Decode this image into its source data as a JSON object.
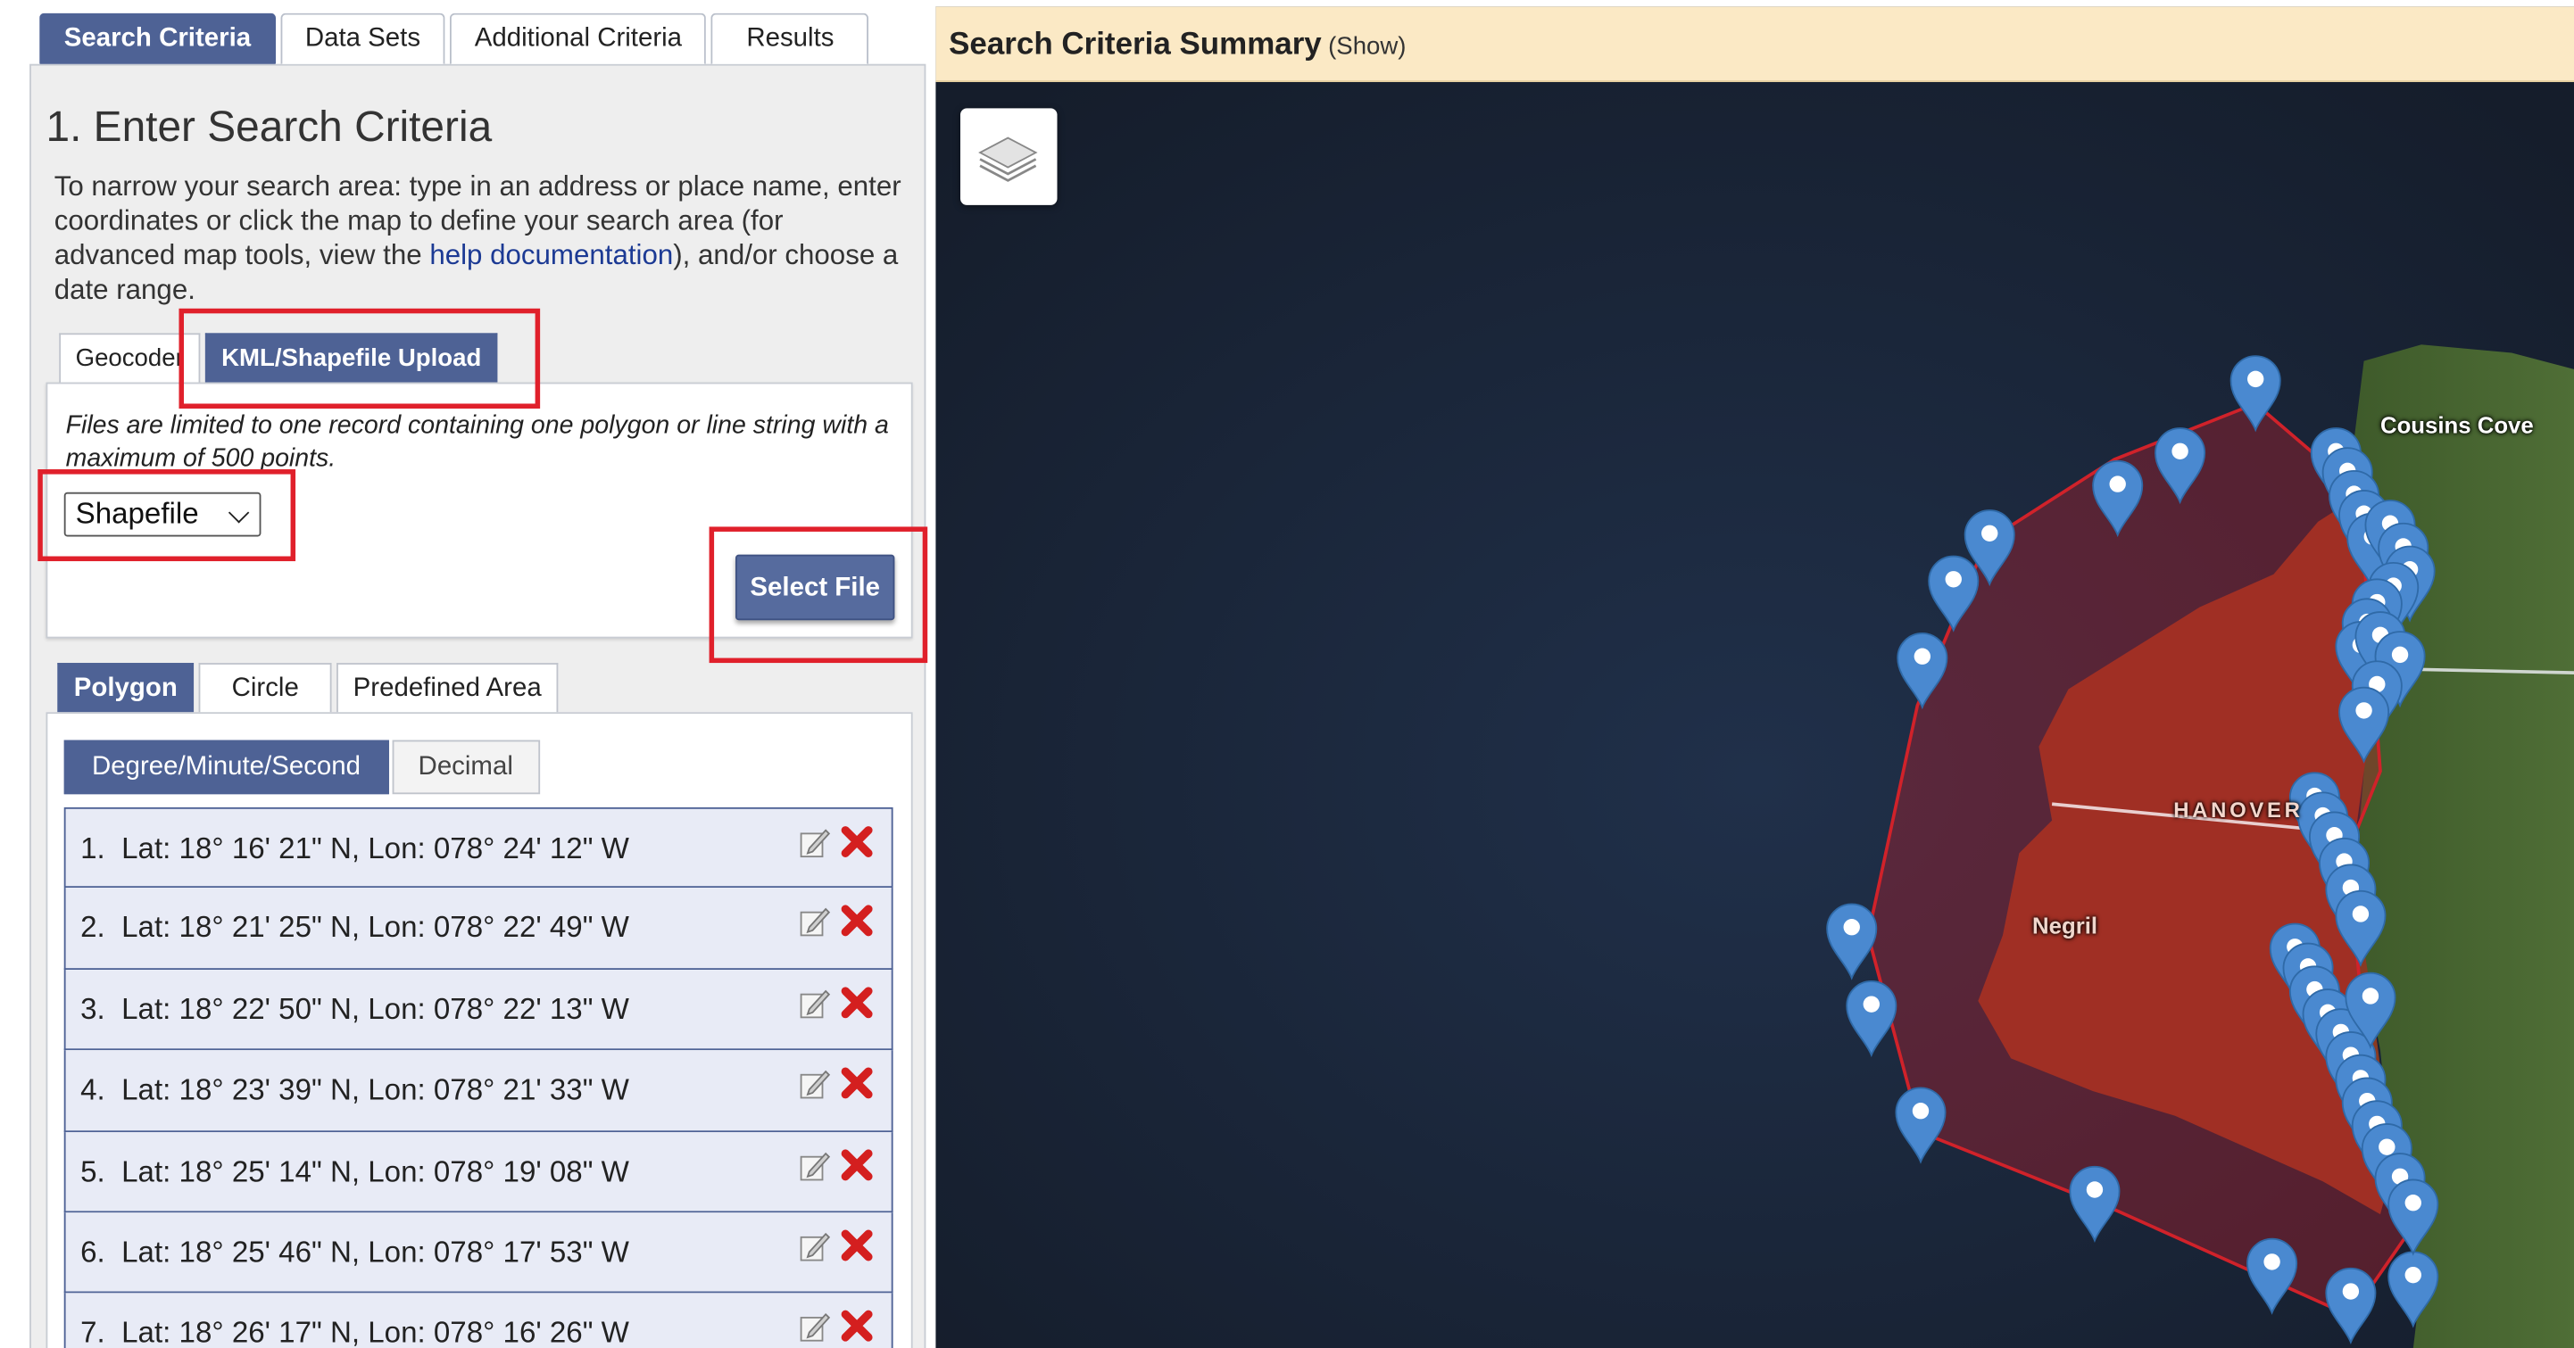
{
  "main_tabs": [
    "Search Criteria",
    "Data Sets",
    "Additional Criteria",
    "Results"
  ],
  "section_title": "1. Enter Search Criteria",
  "intro": {
    "before_link": "To narrow your search area: type in an address or place name, enter coordinates or click the map to define your search area (for advanced map tools, view the ",
    "link": "help documentation",
    "after_link": "), and/or choose a date range."
  },
  "sub_tabs": [
    "Geocoder",
    "KML/Shapefile Upload"
  ],
  "upload": {
    "note": "Files are limited to one record containing one polygon or line string with a maximum of 500 points.",
    "format_selected": "Shapefile",
    "select_file_label": "Select File"
  },
  "geo_tabs": [
    "Polygon",
    "Circle",
    "Predefined Area"
  ],
  "format_tabs": [
    "Degree/Minute/Second",
    "Decimal"
  ],
  "coordinates": [
    "1.  Lat: 18° 16' 21\" N, Lon: 078° 24' 12\" W",
    "2.  Lat: 18° 21' 25\" N, Lon: 078° 22' 49\" W",
    "3.  Lat: 18° 22' 50\" N, Lon: 078° 22' 13\" W",
    "4.  Lat: 18° 23' 39\" N, Lon: 078° 21' 33\" W",
    "5.  Lat: 18° 25' 14\" N, Lon: 078° 19' 08\" W",
    "6.  Lat: 18° 25' 46\" N, Lon: 078° 17' 53\" W",
    "7.  Lat: 18° 26' 17\" N, Lon: 078° 16' 26\" W"
  ],
  "map": {
    "header_title": "Search Criteria Summary",
    "header_show": "(Show)",
    "labels": [
      "Cousins Cove",
      "HANOVER",
      "Negril"
    ]
  },
  "colors": {
    "tab_active": "#4e6295",
    "highlight": "#e0202b",
    "map_header": "#fbe9c5",
    "marker": "#4a89d0",
    "polygon_stroke": "#d0222a"
  }
}
